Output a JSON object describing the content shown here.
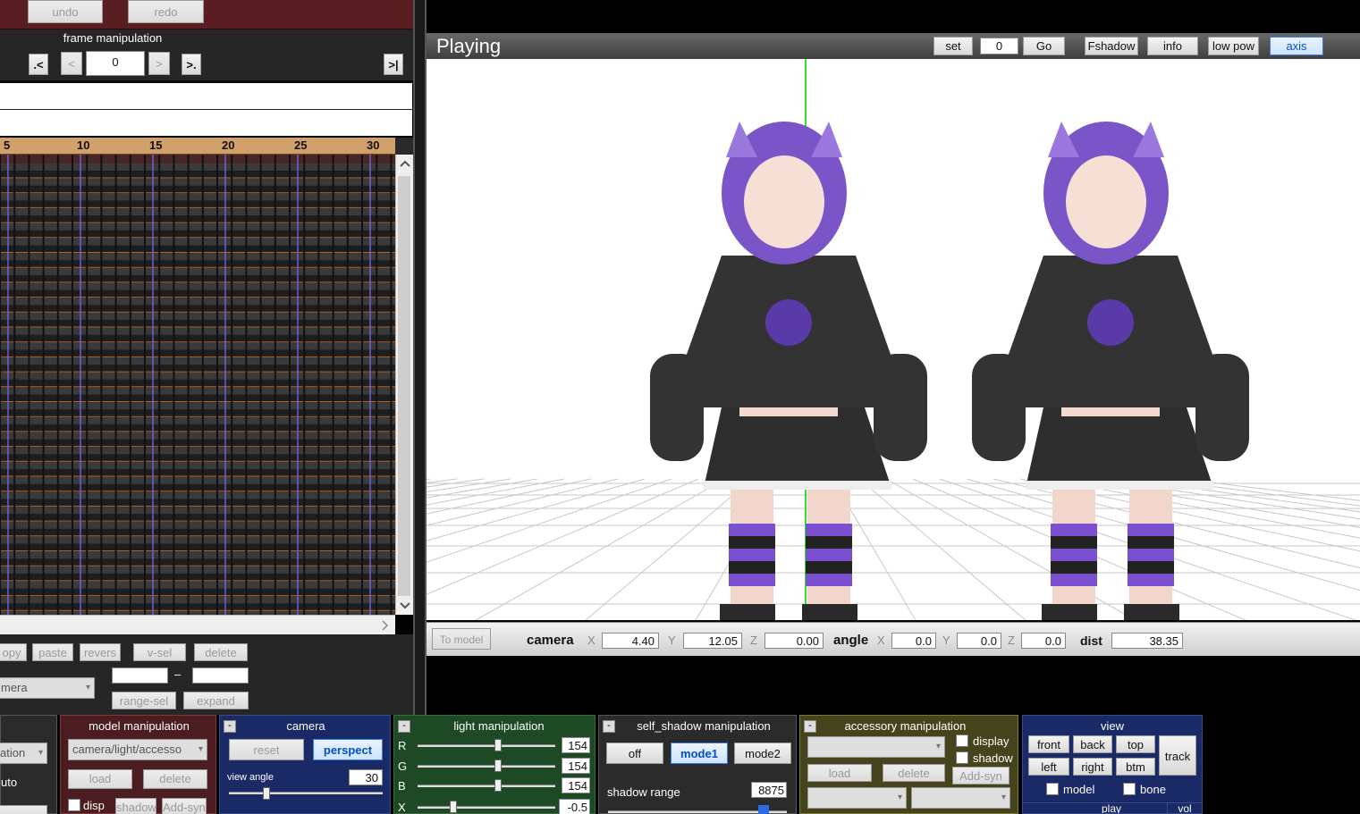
{
  "toolbar": {
    "undo": "undo",
    "redo": "redo"
  },
  "frame": {
    "title": "frame manipulation",
    "first_key": ".<",
    "prev": "<",
    "value": "0",
    "next": ">",
    "next_key": ">.",
    "last": ">|"
  },
  "timeline": {
    "ticks": [
      "5",
      "10",
      "15",
      "20",
      "25",
      "30"
    ],
    "buttons": {
      "copy": "opy",
      "paste": "paste",
      "reverse": "revers",
      "vsel": "v-sel",
      "delete": "delete",
      "range_sel": "range-sel",
      "expand": "expand"
    },
    "range_dash": "–",
    "target_combo": "mera"
  },
  "viewport": {
    "title": "Playing",
    "set": "set",
    "frame_value": "0",
    "go": "Go",
    "fshadow": "Fshadow",
    "info": "info",
    "low_pow": "low pow",
    "axis": "axis"
  },
  "footer": {
    "to_model": "To model",
    "camera_label": "camera",
    "x_label": "X",
    "y_label": "Y",
    "z_label": "Z",
    "cam_x": "4.40",
    "cam_y": "12.05",
    "cam_z": "0.00",
    "angle_label": "angle",
    "ang_x": "0.0",
    "ang_y": "0.0",
    "ang_z": "0.0",
    "dist_label": "dist",
    "dist": "38.35"
  },
  "panels": {
    "left": {
      "combo": "ation",
      "label": "uto"
    },
    "model": {
      "title": "model manipulation",
      "combo": "camera/light/accesso",
      "load": "load",
      "delete": "delete",
      "disp": "disp",
      "shadow": "shadow",
      "add_syn": "Add-syn"
    },
    "camera": {
      "title": "camera",
      "reset": "reset",
      "perspect": "perspect",
      "view_angle_label": "view angle",
      "view_angle": "30",
      "collapse": "-"
    },
    "light": {
      "title": "light manipulation",
      "r_label": "R",
      "g_label": "G",
      "b_label": "B",
      "x_label": "X",
      "r": "154",
      "g": "154",
      "b": "154",
      "x": "-0.5",
      "collapse": "-"
    },
    "shadow": {
      "title": "self_shadow manipulation",
      "off": "off",
      "mode1": "mode1",
      "mode2": "mode2",
      "range_label": "shadow range",
      "range": "8875",
      "collapse": "-"
    },
    "accessory": {
      "title": "accessory manipulation",
      "display": "display",
      "shadow": "shadow",
      "load": "load",
      "delete": "delete",
      "add_syn": "Add-syn",
      "collapse": "-"
    },
    "view": {
      "title": "view",
      "front": "front",
      "back": "back",
      "top": "top",
      "left": "left",
      "right": "right",
      "btm": "btm",
      "track": "track",
      "model": "model",
      "bone": "bone",
      "play": "play",
      "vol": "vol"
    }
  },
  "colors": {
    "accent": "#0050c8",
    "timeline_bg": "#3b3b3b",
    "ruler": "#d2a06a",
    "axis_green": "#33dd33"
  },
  "icons": {
    "scroll_up": "chevron-up-icon",
    "scroll_down": "chevron-down-icon",
    "scroll_right": "chevron-right-icon"
  }
}
